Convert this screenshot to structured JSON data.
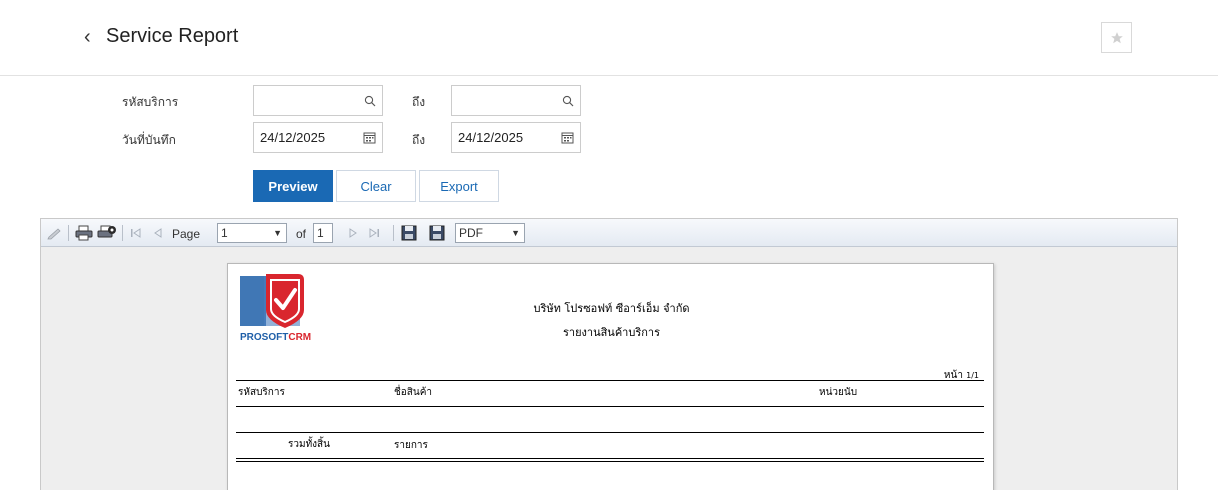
{
  "header": {
    "back_glyph": "‹",
    "title": "Service Report",
    "favorite_icon": "star-icon"
  },
  "filters": {
    "service_code_label": "รหัสบริการ",
    "to_label": "ถึง",
    "record_date_label": "วันที่บันทึก",
    "service_code_from": "",
    "service_code_to": "",
    "date_from": "24/12/2025",
    "date_to": "24/12/2025"
  },
  "actions": {
    "preview": "Preview",
    "clear": "Clear",
    "export": "Export"
  },
  "viewer_toolbar": {
    "page_label": "Page",
    "page_value": "1",
    "of_label": "of",
    "total_pages": "1",
    "format_value": "PDF"
  },
  "report": {
    "logo_text_main": "PROSOFT",
    "logo_text_accent": "CRM",
    "company_name": "บริษัท โปรซอฟท์ ซีอาร์เอ็ม จำกัด",
    "report_title": "รายงานสินค้าบริการ",
    "page_indicator_label": "หน้า",
    "page_indicator_value": "1/1",
    "columns": [
      "รหัสบริการ",
      "ชื่อสินค้า",
      "หน่วยนับ"
    ],
    "total_label": "รวมทั้งสิ้น",
    "items_label": "รายการ"
  },
  "colors": {
    "primary": "#1a69b4",
    "logo_red": "#d9262e",
    "logo_blue": "#1f5fa8"
  }
}
